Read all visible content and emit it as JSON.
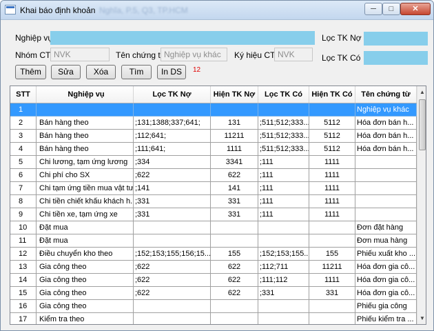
{
  "window": {
    "title": "Khai báo định khoản",
    "title_obscured": "Nghĩa, P.5, Q3, TP.HCM",
    "controls": [
      "minimize",
      "maximize",
      "close"
    ]
  },
  "form": {
    "nghiep_vu_label": "Nghiệp vụ",
    "nghiep_vu_value": "",
    "loc_tk_no_label": "Lọc TK Nợ",
    "loc_tk_no_value": "",
    "nhom_ct_label": "Nhóm CT",
    "nhom_ct_value": "NVK",
    "ten_chung_tu_label": "Tên chứng từ",
    "ten_chung_tu_value": "Nghiệp vụ khác",
    "ky_hieu_ct_label": "Ký hiệu CT",
    "ky_hieu_ct_value": "NVK",
    "loc_tk_co_label": "Lọc TK Có",
    "loc_tk_co_value": ""
  },
  "buttons": {
    "them": "Thêm",
    "sua": "Sửa",
    "xoa": "Xóa",
    "tim": "Tìm",
    "in_ds": "In DS"
  },
  "record_count": "12",
  "colors": {
    "highlight_field": "#87ceeb",
    "selected_row": "#3399ff",
    "count_text": "#e00000"
  },
  "table": {
    "headers": {
      "stt": "STT",
      "nghiep_vu": "Nghiệp vụ",
      "loc_tk_no": "Lọc TK Nợ",
      "hien_tk_no": "Hiện TK Nợ",
      "loc_tk_co": "Lọc TK Có",
      "hien_tk_co": "Hiện TK Có",
      "ten_chung_tu": "Tên chứng từ"
    },
    "rows": [
      {
        "stt": "1",
        "nghiep_vu": "",
        "loc_tk_no": "",
        "hien_tk_no": "",
        "loc_tk_co": "",
        "hien_tk_co": "",
        "ten_chung_tu": "Nghiệp vụ khác",
        "selected": true
      },
      {
        "stt": "2",
        "nghiep_vu": "Bán hàng theo",
        "loc_tk_no": ";131;1388;337;641;",
        "hien_tk_no": "131",
        "loc_tk_co": ";511;512;333...",
        "hien_tk_co": "5112",
        "ten_chung_tu": "Hóa đơn bán h..."
      },
      {
        "stt": "3",
        "nghiep_vu": "Bán hàng theo",
        "loc_tk_no": ";112;641;",
        "hien_tk_no": "11211",
        "loc_tk_co": ";511;512;333...",
        "hien_tk_co": "5112",
        "ten_chung_tu": "Hóa đơn bán h..."
      },
      {
        "stt": "4",
        "nghiep_vu": "Bán hàng theo",
        "loc_tk_no": ";111;641;",
        "hien_tk_no": "1111",
        "loc_tk_co": ";511;512;333...",
        "hien_tk_co": "5112",
        "ten_chung_tu": "Hóa đơn bán h..."
      },
      {
        "stt": "5",
        "nghiep_vu": "Chi lương, tạm ứng lương",
        "loc_tk_no": ";334",
        "hien_tk_no": "3341",
        "loc_tk_co": ";111",
        "hien_tk_co": "1111",
        "ten_chung_tu": ""
      },
      {
        "stt": "6",
        "nghiep_vu": "Chi phí cho SX",
        "loc_tk_no": ";622",
        "hien_tk_no": "622",
        "loc_tk_co": ";111",
        "hien_tk_co": "1111",
        "ten_chung_tu": ""
      },
      {
        "stt": "7",
        "nghiep_vu": "Chi tạm ứng tiền mua vật tư",
        "loc_tk_no": ";141",
        "hien_tk_no": "141",
        "loc_tk_co": ";111",
        "hien_tk_co": "1111",
        "ten_chung_tu": ""
      },
      {
        "stt": "8",
        "nghiep_vu": "Chi tiền chiết khấu khách h...",
        "loc_tk_no": ";331",
        "hien_tk_no": "331",
        "loc_tk_co": ";111",
        "hien_tk_co": "1111",
        "ten_chung_tu": ""
      },
      {
        "stt": "9",
        "nghiep_vu": "Chi tiền xe, tạm ứng xe",
        "loc_tk_no": ";331",
        "hien_tk_no": "331",
        "loc_tk_co": ";111",
        "hien_tk_co": "1111",
        "ten_chung_tu": ""
      },
      {
        "stt": "10",
        "nghiep_vu": "Đặt mua",
        "loc_tk_no": "",
        "hien_tk_no": "",
        "loc_tk_co": "",
        "hien_tk_co": "",
        "ten_chung_tu": "Đơn đặt hàng"
      },
      {
        "stt": "11",
        "nghiep_vu": "Đặt mua",
        "loc_tk_no": "",
        "hien_tk_no": "",
        "loc_tk_co": "",
        "hien_tk_co": "",
        "ten_chung_tu": "Đơn mua hàng"
      },
      {
        "stt": "12",
        "nghiep_vu": "Điều chuyển kho theo",
        "loc_tk_no": ";152;153;155;156;15...",
        "hien_tk_no": "155",
        "loc_tk_co": ";152;153;155...",
        "hien_tk_co": "155",
        "ten_chung_tu": "Phiếu xuất kho ..."
      },
      {
        "stt": "13",
        "nghiep_vu": "Gia công theo",
        "loc_tk_no": ";622",
        "hien_tk_no": "622",
        "loc_tk_co": ";112;711",
        "hien_tk_co": "11211",
        "ten_chung_tu": "Hóa đơn gia cô..."
      },
      {
        "stt": "14",
        "nghiep_vu": "Gia công theo",
        "loc_tk_no": ";622",
        "hien_tk_no": "622",
        "loc_tk_co": ";111;112",
        "hien_tk_co": "1111",
        "ten_chung_tu": "Hóa đơn gia cô..."
      },
      {
        "stt": "15",
        "nghiep_vu": "Gia công theo",
        "loc_tk_no": ";622",
        "hien_tk_no": "622",
        "loc_tk_co": ";331",
        "hien_tk_co": "331",
        "ten_chung_tu": "Hóa đơn gia cô..."
      },
      {
        "stt": "16",
        "nghiep_vu": "Gia công theo",
        "loc_tk_no": "",
        "hien_tk_no": "",
        "loc_tk_co": "",
        "hien_tk_co": "",
        "ten_chung_tu": "Phiếu gia công"
      },
      {
        "stt": "17",
        "nghiep_vu": "Kiểm tra theo",
        "loc_tk_no": "",
        "hien_tk_no": "",
        "loc_tk_co": "",
        "hien_tk_co": "",
        "ten_chung_tu": "Phiếu kiểm tra ..."
      }
    ]
  }
}
